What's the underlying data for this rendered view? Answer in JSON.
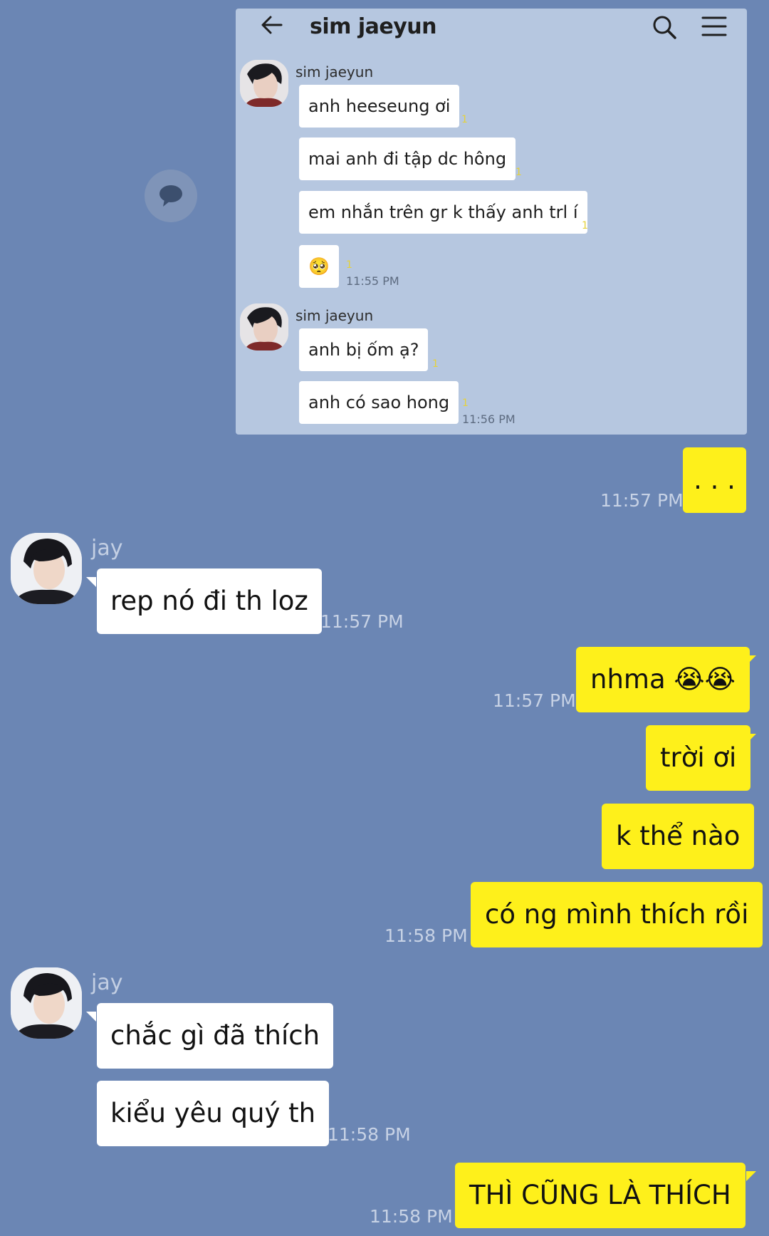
{
  "colors": {
    "background": "#6b86b4",
    "embedded_background": "#b6c7e0",
    "my_bubble": "#fef01b",
    "their_bubble": "#ffffff"
  },
  "embedded": {
    "header": {
      "back_icon": "arrow-left-icon",
      "title": "sim jaeyun",
      "search_icon": "search-icon",
      "menu_icon": "hamburger-menu-icon"
    },
    "groups": [
      {
        "sender": "sim jaeyun",
        "messages": [
          {
            "text": "anh heeseung ơi",
            "read": "1"
          },
          {
            "text": "mai anh đi tập dc hông",
            "read": "1"
          },
          {
            "text": "em nhắn trên gr k thấy anh trl í",
            "read": "1"
          },
          {
            "text": "🥺",
            "read": "1",
            "time": "11:55 PM"
          }
        ]
      },
      {
        "sender": "sim jaeyun",
        "messages": [
          {
            "text": "anh bị ốm ạ?",
            "read": "1"
          },
          {
            "text": "anh có sao hong",
            "read": "1",
            "time": "11:56 PM"
          }
        ]
      }
    ]
  },
  "share_icon": "speech-bubble-icon",
  "messages": [
    {
      "from": "me",
      "text": ". . .",
      "time": "11:57 PM"
    },
    {
      "from": "jay",
      "sender": "jay",
      "text": "rep nó đi th loz",
      "time": "11:57 PM"
    },
    {
      "from": "me",
      "text": "nhma 😭😭",
      "time": "11:57 PM"
    },
    {
      "from": "me",
      "text": "trời ơi"
    },
    {
      "from": "me",
      "text": "k thể nào"
    },
    {
      "from": "me",
      "text": "có ng mình thích rồi",
      "time": "11:58 PM"
    },
    {
      "from": "jay",
      "sender": "jay",
      "text": "chắc gì đã thích"
    },
    {
      "from": "jay",
      "text": "kiểu yêu quý th",
      "time": "11:58 PM"
    },
    {
      "from": "me",
      "text": "THÌ CŨNG LÀ THÍCH",
      "time": "11:58 PM"
    }
  ]
}
